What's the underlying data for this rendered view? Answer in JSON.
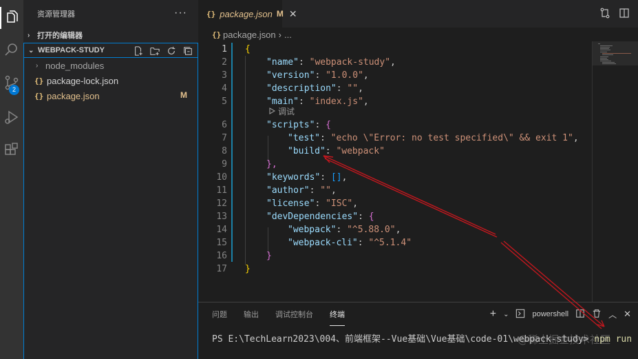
{
  "colors": {
    "accent": "#007fd4",
    "modified": "#e2c08d",
    "annotation_arrow": "#c0181e"
  },
  "activity_bar": {
    "icons": [
      "explorer-icon",
      "search-icon",
      "source-control-icon",
      "run-debug-icon",
      "extensions-icon"
    ],
    "source_control_badge": "2"
  },
  "sidebar": {
    "title": "资源管理器",
    "more": "···",
    "open_editors": "打开的编辑器",
    "project": "WEBPACK-STUDY",
    "items": [
      {
        "label": "node_modules",
        "type": "folder"
      },
      {
        "label": "package-lock.json",
        "type": "file",
        "icon": "{}"
      },
      {
        "label": "package.json",
        "type": "file",
        "icon": "{}",
        "status": "M"
      }
    ]
  },
  "editor": {
    "tab": {
      "icon": "{}",
      "label": "package.json",
      "status": "M",
      "close": "✕"
    },
    "breadcrumb": {
      "icon": "{}",
      "file": "package.json",
      "sep": "›",
      "more": "..."
    },
    "codelens": "调试",
    "lines": [
      {
        "n": "1",
        "code": "{"
      },
      {
        "n": "2",
        "code": "\"name\": \"webpack-study\","
      },
      {
        "n": "3",
        "code": "\"version\": \"1.0.0\","
      },
      {
        "n": "4",
        "code": "\"description\": \"\","
      },
      {
        "n": "5",
        "code": "\"main\": \"index.js\","
      },
      {
        "n": "6",
        "code": "\"scripts\": {"
      },
      {
        "n": "7",
        "code": "\"test\": \"echo \\\"Error: no test specified\\\" && exit 1\","
      },
      {
        "n": "8",
        "code": "\"build\": \"webpack\""
      },
      {
        "n": "9",
        "code": "},"
      },
      {
        "n": "10",
        "code": "\"keywords\": [],"
      },
      {
        "n": "11",
        "code": "\"author\": \"\","
      },
      {
        "n": "12",
        "code": "\"license\": \"ISC\","
      },
      {
        "n": "13",
        "code": "\"devDependencies\": {"
      },
      {
        "n": "14",
        "code": "\"webpack\": \"^5.88.0\","
      },
      {
        "n": "15",
        "code": "\"webpack-cli\": \"^5.1.4\""
      },
      {
        "n": "16",
        "code": "}"
      },
      {
        "n": "17",
        "code": "}"
      }
    ]
  },
  "panel": {
    "tabs": [
      "问题",
      "输出",
      "调试控制台",
      "终端"
    ],
    "active_tab": "终端",
    "terminal_name": "powershell",
    "prompt": "PS E:\\TechLearn2023\\004、前端框架--Vue基础\\Vue基础\\code-01\\webpack-study> ",
    "command": "npm run build"
  },
  "watermark": "@稀土掘金技术社区"
}
